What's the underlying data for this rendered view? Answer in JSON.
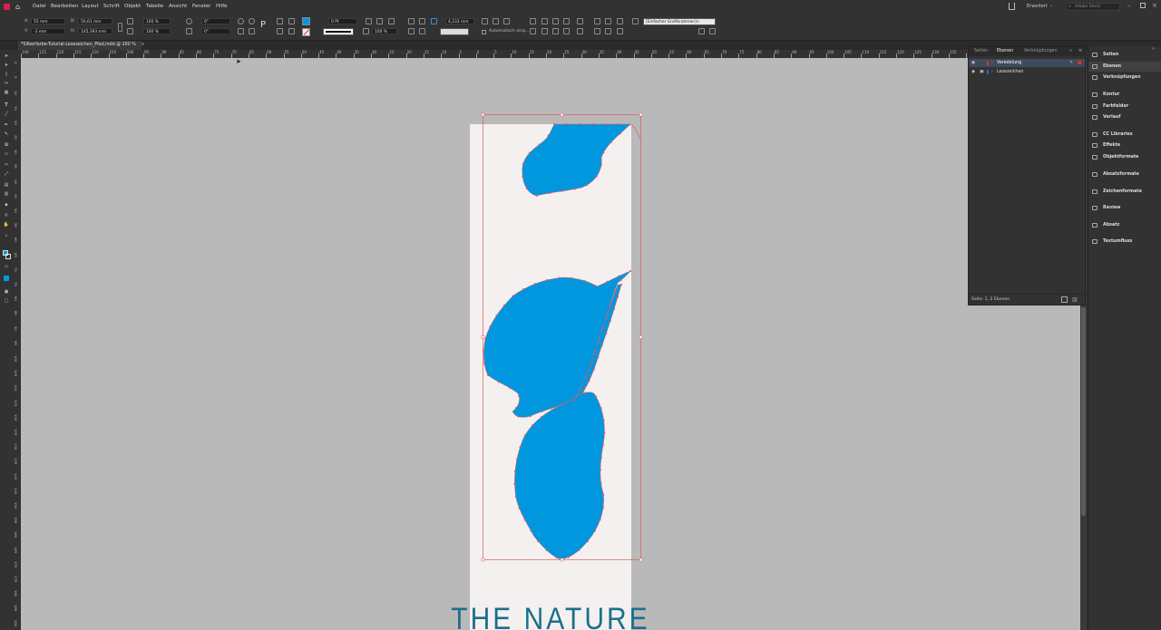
{
  "menubar": {
    "items": [
      "Datei",
      "Bearbeiten",
      "Layout",
      "Schrift",
      "Objekt",
      "Tabelle",
      "Ansicht",
      "Fenster",
      "Hilfe"
    ],
    "workspace": "Erweitert",
    "search_placeholder": "Adobe Stock"
  },
  "control": {
    "x_label": "X:",
    "x_value": "55 mm",
    "y_label": "Y:",
    "y_value": "-3 mm",
    "w_label": "B:",
    "w_value": "50,61 mm",
    "h_label": "H:",
    "h_value": "145,393 mm",
    "scale_x": "100 %",
    "scale_y": "100 %",
    "rotate": "0°",
    "shear": "0°",
    "stroke_weight": "0 Pt",
    "opacity": "100 %",
    "gap": "4,233 mm",
    "auto_fit": "Automatisch einp...",
    "frame_style": "[Einfacher Grafikrahmen]+",
    "fill_color": "#0099e0"
  },
  "document_tab": {
    "title": "*Silberfarbe-Tutorial-Lesezeichen_Pfad.indd @ 200 %",
    "close": "×"
  },
  "hruler_labels": [
    "140",
    "125",
    "120",
    "115",
    "110",
    "105",
    "100",
    "95",
    "90",
    "85",
    "80",
    "75",
    "70",
    "65",
    "60",
    "55",
    "50",
    "45",
    "40",
    "35",
    "30",
    "25",
    "20",
    "15",
    "10",
    "5",
    "0",
    "5",
    "10",
    "15",
    "20",
    "25",
    "30",
    "35",
    "40",
    "45",
    "50",
    "55",
    "60",
    "65",
    "70",
    "75",
    "80",
    "85",
    "90",
    "95",
    "100",
    "105",
    "110",
    "115",
    "120",
    "125",
    "130",
    "135",
    "140"
  ],
  "vruler_labels": [
    "0",
    "5",
    "10",
    "15",
    "20",
    "25",
    "30",
    "35",
    "40",
    "45",
    "50",
    "55",
    "60",
    "65",
    "70",
    "75",
    "80",
    "85",
    "90",
    "95",
    "100",
    "105",
    "110",
    "115",
    "120",
    "125",
    "130",
    "135",
    "140",
    "145",
    "150",
    "155",
    "160",
    "165",
    "170",
    "175",
    "180",
    "185",
    "190"
  ],
  "layers_panel": {
    "tabs": [
      "Seiten",
      "Ebenen",
      "Verknüpfungen"
    ],
    "active_tab": "Ebenen",
    "layers": [
      {
        "name": "Veredelung",
        "color": "#e03030",
        "selected": true
      },
      {
        "name": "Lesezeichen",
        "color": "#3060e0",
        "selected": false
      }
    ],
    "footer": "Seite: 1, 2 Ebenen"
  },
  "dock": {
    "items": [
      {
        "label": "Seiten",
        "icon": "pages-icon"
      },
      {
        "label": "Ebenen",
        "icon": "layers-icon"
      },
      {
        "label": "Verknüpfungen",
        "icon": "links-icon"
      },
      {
        "label": "Kontur",
        "icon": "stroke-icon"
      },
      {
        "label": "Farbfelder",
        "icon": "swatches-icon"
      },
      {
        "label": "Verlauf",
        "icon": "gradient-icon"
      },
      {
        "label": "CC Libraries",
        "icon": "cc-libraries-icon"
      },
      {
        "label": "Effekte",
        "icon": "effects-icon"
      },
      {
        "label": "Objektformate",
        "icon": "object-styles-icon"
      },
      {
        "label": "Absatzformate",
        "icon": "paragraph-styles-icon"
      },
      {
        "label": "Zeichenformate",
        "icon": "character-styles-icon"
      },
      {
        "label": "Review",
        "icon": "review-icon"
      },
      {
        "label": "Absatz",
        "icon": "paragraph-icon"
      },
      {
        "label": "Textumfluss",
        "icon": "text-wrap-icon"
      }
    ]
  },
  "canvas": {
    "bookmark_text": "THE NATURE",
    "leaf_color": "#0097df",
    "page_color": "#f4f0f0",
    "text_color": "#1a6f8c",
    "selection_color": "#e05a5a"
  }
}
